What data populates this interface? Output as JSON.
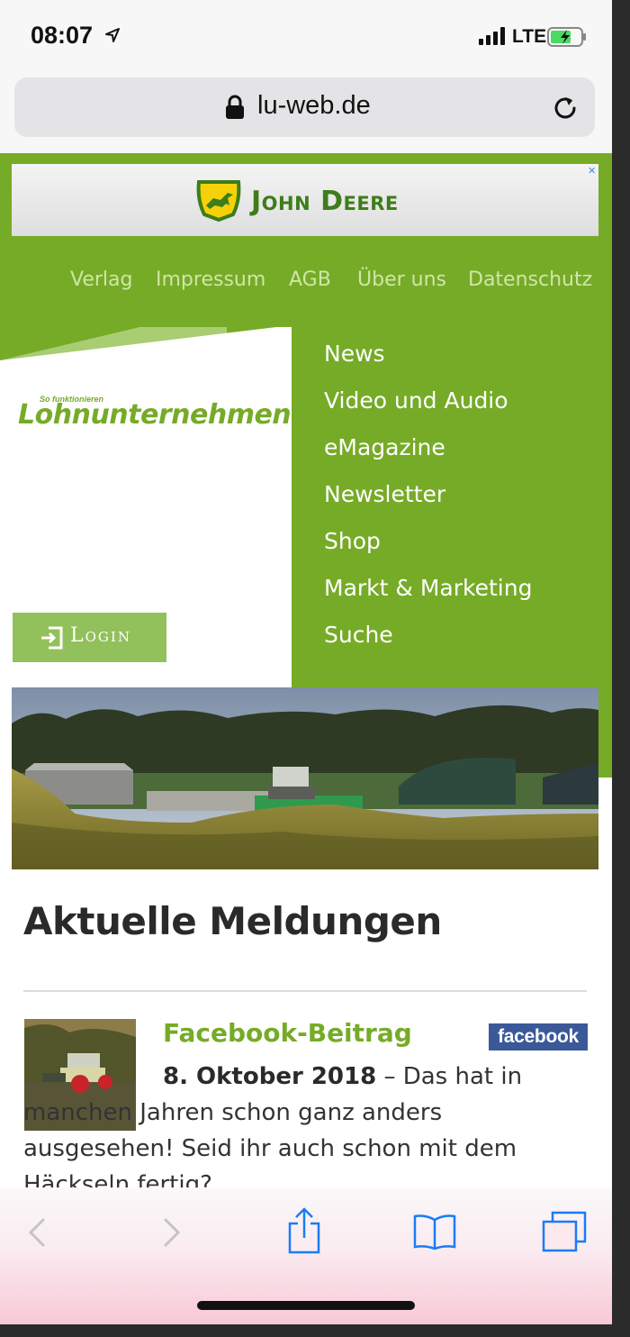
{
  "status_bar": {
    "time": "08:07",
    "network": "LTE"
  },
  "browser": {
    "url": "lu-web.de"
  },
  "ad": {
    "brand": "John Deere",
    "close": "×"
  },
  "top_nav": [
    "Verlag",
    "Impressum",
    "AGB",
    "Über uns",
    "Datenschutz"
  ],
  "logo": {
    "tagline": "So funktionieren",
    "name": "Lohnunternehmen"
  },
  "login": {
    "label": "Login"
  },
  "main_nav": [
    "News",
    "Video und Audio",
    "eMagazine",
    "Newsletter",
    "Shop",
    "Markt & Marketing",
    "Suche"
  ],
  "section": {
    "title": "Aktuelle Meldungen"
  },
  "news": [
    {
      "title": "Facebook-Beitrag",
      "badge": "facebook",
      "date": "8. Oktober 2018",
      "separator": " – ",
      "text": "Das hat in manchen Jahren schon ganz anders ausgesehen! Seid ihr auch schon mit dem Häckseln fertig?"
    }
  ],
  "colors": {
    "brand_green": "#76ab27",
    "light_green": "#92c05a",
    "facebook_blue": "#3b5998"
  },
  "icons": [
    "location-arrow-icon",
    "signal-icon",
    "battery-icon",
    "lock-icon",
    "reload-icon",
    "john-deere-logo",
    "login-icon",
    "back-icon",
    "forward-icon",
    "share-icon",
    "bookmarks-icon",
    "tabs-icon"
  ]
}
